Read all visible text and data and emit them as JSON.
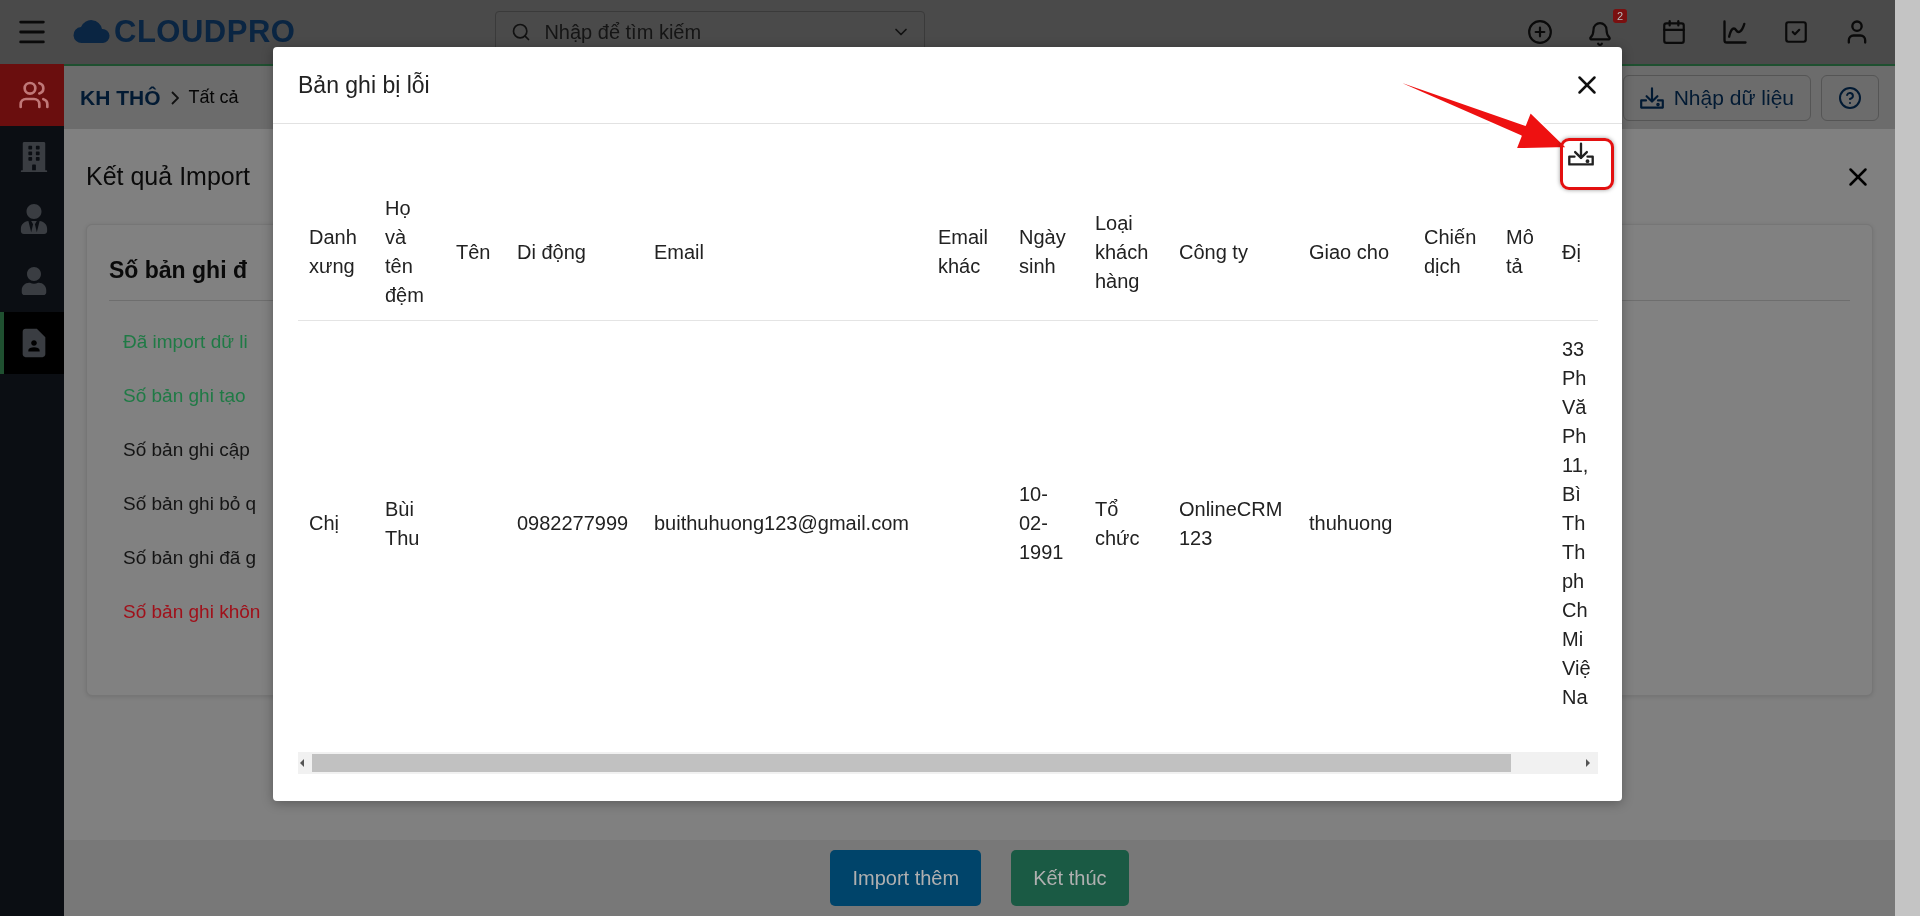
{
  "top_bar": {
    "logo": "CLOUDPRO",
    "search": {
      "placeholder": "Nhập để tìm kiếm"
    },
    "notification_count": "2"
  },
  "sidebar": {
    "module": {
      "kind": "people"
    },
    "items": [
      {
        "kind": "building",
        "selected": false
      },
      {
        "kind": "tie",
        "selected": false
      },
      {
        "kind": "person",
        "selected": false
      },
      {
        "kind": "contact",
        "selected": true
      }
    ]
  },
  "breadcrumb": {
    "module": "KH THÔ",
    "view": "Tất cả",
    "import_button": "Nhập dữ liệu"
  },
  "page": {
    "title": "Kết quả Import",
    "card": {
      "heading": "Số bản ghi đ",
      "lines": [
        {
          "text": "Đã import dữ li",
          "color": "#1f7a45"
        },
        {
          "text": "Số bản ghi tạo",
          "color": "#1f7a45"
        },
        {
          "text": "Số bản ghi cập",
          "color": "#141414"
        },
        {
          "text": "Số bản ghi bỏ q",
          "color": "#141414"
        },
        {
          "text": "Số bản ghi đã g",
          "color": "#141414"
        },
        {
          "text": "Số bản ghi khôn",
          "color": "#a0101a"
        }
      ]
    }
  },
  "footer_buttons": [
    {
      "label": "Import thêm",
      "kind": "primary"
    },
    {
      "label": "Kết thúc",
      "kind": "success"
    }
  ],
  "modal": {
    "title": "Bản ghi bị lỗi",
    "columns": [
      "Danh xưng",
      "Họ và tên đệm",
      "Tên",
      "Di động",
      "Email",
      "Email khác",
      "Ngày sinh",
      "Loại khách hàng",
      "Công ty",
      "Giao cho",
      "Chiến dịch",
      "Mô tả",
      "Đị"
    ],
    "rows": [
      {
        "cells": [
          "Chị",
          "Bùi Thu",
          null,
          "0982277999",
          "buithuhuong123@gmail.com",
          null,
          "10-02-1991",
          "Tổ chức",
          "OnlineCRM 123",
          "thuhuong",
          null,
          null,
          "33 Ph Vă Ph 11, Bì Th Th ph Ch Mi Việ Na"
        ]
      }
    ]
  }
}
